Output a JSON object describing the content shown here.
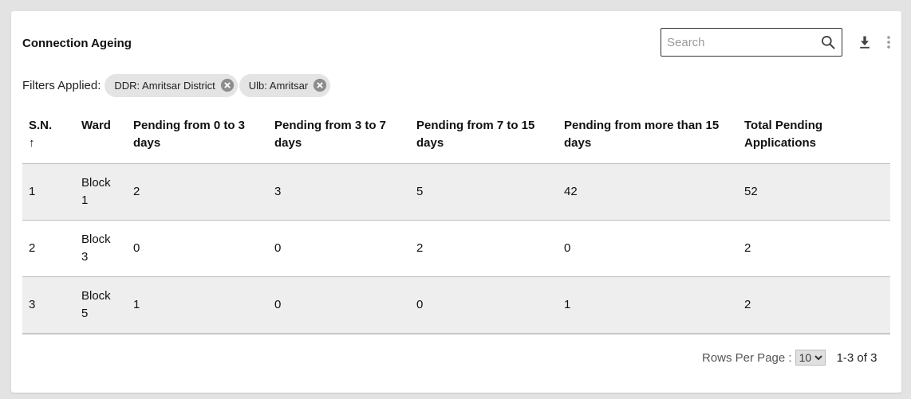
{
  "card": {
    "title": "Connection Ageing",
    "search_placeholder": "Search",
    "icons": {
      "search": "search-icon",
      "download": "download-icon",
      "more": "more-vert-icon"
    }
  },
  "filters": {
    "label": "Filters Applied:",
    "chips": [
      {
        "label": "DDR: Amritsar District"
      },
      {
        "label": "Ulb: Amritsar"
      }
    ]
  },
  "table": {
    "headers": {
      "sn": "S.N.",
      "sn_sort": "↑",
      "ward": "Ward",
      "p0_3": "Pending from 0 to 3 days",
      "p3_7": "Pending from 3 to 7 days",
      "p7_15": "Pending from 7 to 15 days",
      "p15plus": "Pending from more than 15 days",
      "total": "Total Pending Applications"
    },
    "rows": [
      {
        "sn": "1",
        "ward": "Block 1",
        "p0_3": "2",
        "p3_7": "3",
        "p7_15": "5",
        "p15plus": "42",
        "total": "52"
      },
      {
        "sn": "2",
        "ward": "Block 3",
        "p0_3": "0",
        "p3_7": "0",
        "p7_15": "2",
        "p15plus": "0",
        "total": "2"
      },
      {
        "sn": "3",
        "ward": "Block 5",
        "p0_3": "1",
        "p3_7": "0",
        "p7_15": "0",
        "p15plus": "1",
        "total": "2"
      }
    ]
  },
  "pagination": {
    "rows_per_page_label": "Rows Per Page :",
    "rows_per_page_value": "10",
    "range": "1-3 of 3"
  }
}
